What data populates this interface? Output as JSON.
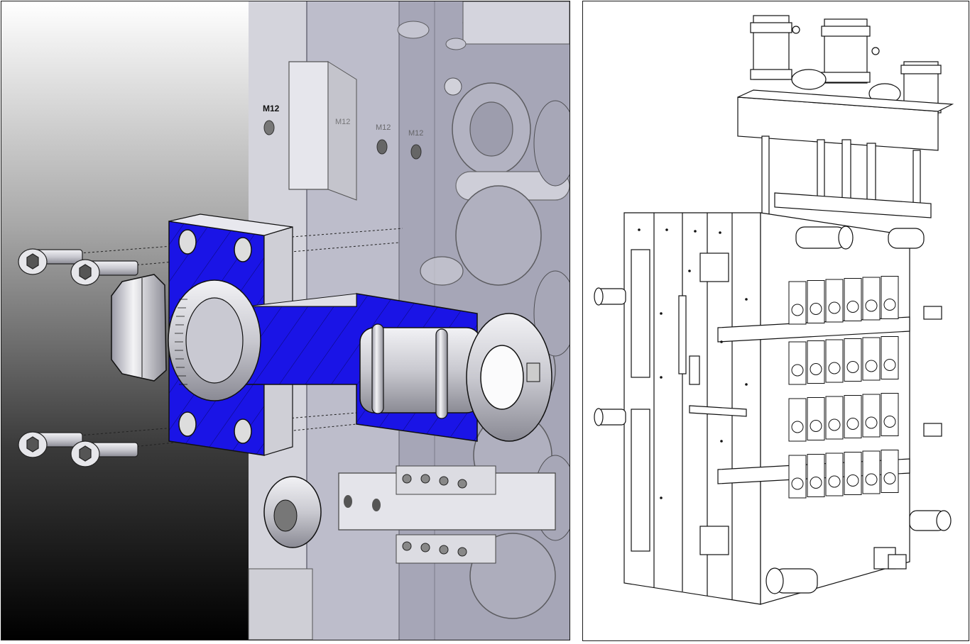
{
  "left_figure": {
    "labels": [
      "M12",
      "M12",
      "M12",
      "M12"
    ]
  },
  "colors": {
    "section_fill": "#1a14e6",
    "background_top": "#ffffff",
    "background_bottom": "#000000",
    "metal_light": "#d9d9de",
    "metal_dark": "#7c7c86"
  }
}
